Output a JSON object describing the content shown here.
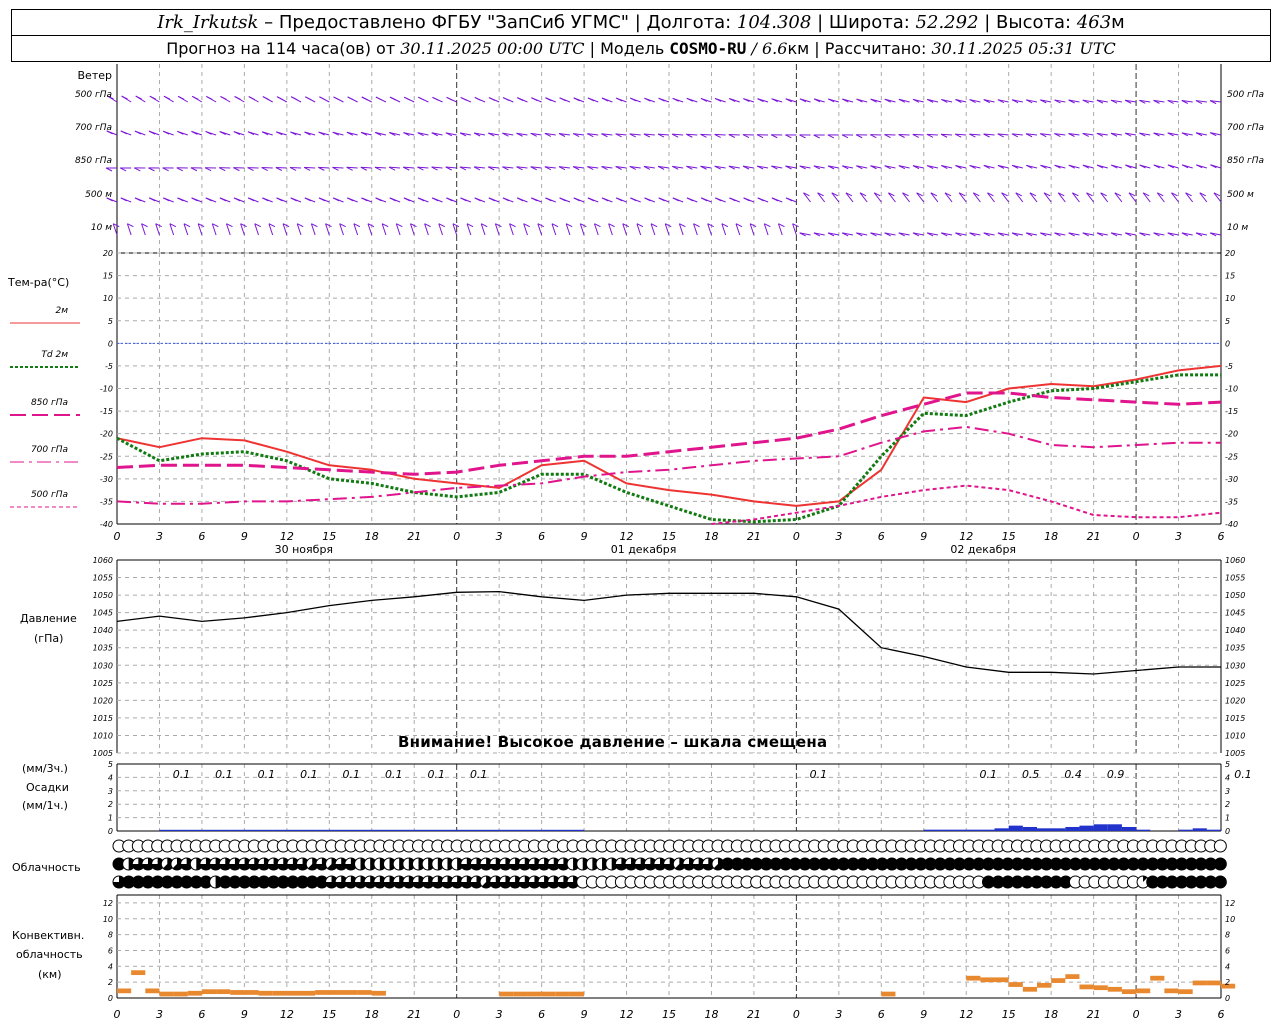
{
  "header": {
    "line1": {
      "station": "Irk_Irkutsk",
      "provider": " – Предоставлено ФГБУ \"ЗапСиб УГМС\" | Долгота: ",
      "lon": "104.308",
      "lat_label": " | Широта: ",
      "lat": "52.292",
      "alt_label": " | Высота: ",
      "alt": "463",
      "alt_unit": "м"
    },
    "line2": {
      "prefix": "Прогноз на 114 часа(ов) от ",
      "run_time": "30.11.2025 00:00 UTC",
      "model_label": "  | Модель ",
      "model": "COSMO-RU",
      "sep": " / ",
      "res": "6.6",
      "res_unit": "км",
      "calc_label": " | Рассчитано: ",
      "calc_time": "30.11.2025 05:31 UTC"
    }
  },
  "wind_panel": {
    "title": "Ветер",
    "levels": [
      "500 гПа",
      "700 гПа",
      "850 гПа",
      "500 м",
      "10 м"
    ],
    "barb_color": "#7a16d6"
  },
  "temp_panel": {
    "title": "Тем-ра(°C)",
    "legend": [
      {
        "label": "2м",
        "color": "#ee3333"
      },
      {
        "label": "Td  2м",
        "color": "#117a11"
      },
      {
        "label": "850 гПа",
        "color": "#e0148c"
      },
      {
        "label": "700 гПа",
        "color": "#e0148c"
      },
      {
        "label": "500 гПа",
        "color": "#e0148c"
      }
    ]
  },
  "time_axis": {
    "hours": [
      "0",
      "3",
      "6",
      "9",
      "12",
      "15",
      "18",
      "21",
      "0",
      "3",
      "6",
      "9",
      "12",
      "15",
      "18",
      "21",
      "0",
      "3",
      "6",
      "9",
      "12",
      "15",
      "18",
      "21",
      "0",
      "3",
      "6"
    ],
    "dates": [
      "30 ноября",
      "01 декабря",
      "02 декабря"
    ]
  },
  "pressure_panel": {
    "title_line1": "Давление",
    "title_line2": "(гПа)",
    "warning": "Внимание! Высокое давление – шкала смещена"
  },
  "precip_panel": {
    "label_line1": "(мм/3ч.)",
    "label_line2": "Осадки",
    "label_line3": "(мм/1ч.)",
    "totals_3h": [
      {
        "hour": 3,
        "value": "0.1"
      },
      {
        "hour": 6,
        "value": "0.1"
      },
      {
        "hour": 9,
        "value": "0.1"
      },
      {
        "hour": 12,
        "value": "0.1"
      },
      {
        "hour": 15,
        "value": "0.1"
      },
      {
        "hour": 18,
        "value": "0.1"
      },
      {
        "hour": 21,
        "value": "0.1"
      },
      {
        "hour": 24,
        "value": "0.1"
      },
      {
        "hour": 48,
        "value": "0.1"
      },
      {
        "hour": 60,
        "value": "0.1"
      },
      {
        "hour": 63,
        "value": "0.5"
      },
      {
        "hour": 66,
        "value": "0.4"
      },
      {
        "hour": 69,
        "value": "0.9"
      },
      {
        "hour": 78,
        "value": "0.1"
      }
    ],
    "bar_color": "#2233cc"
  },
  "cloud_panel": {
    "title": "Облачность"
  },
  "conv_panel": {
    "title_line1": "Конвективн.",
    "title_line2": "облачность",
    "title_line3": "(км)",
    "bar_color": "#e8882f"
  },
  "chart_data": [
    {
      "type": "line",
      "title": "Тем-ра(°C)",
      "x_unit": "hours from 30.11.2025 00:00 UTC",
      "ylim": [
        -40,
        20
      ],
      "yticks": [
        -40,
        -35,
        -30,
        -25,
        -20,
        -15,
        -10,
        -5,
        0,
        5,
        10,
        15,
        20
      ],
      "x": [
        0,
        3,
        6,
        9,
        12,
        15,
        18,
        21,
        24,
        27,
        30,
        33,
        36,
        39,
        42,
        45,
        48,
        51,
        54,
        57,
        60,
        63,
        66,
        69,
        72,
        75,
        78
      ],
      "series": [
        {
          "name": "2м",
          "values": [
            -21,
            -23,
            -21,
            -21.5,
            -24,
            -27,
            -28,
            -30,
            -31,
            -32,
            -27,
            -26,
            -31,
            -32.5,
            -33.5,
            -35,
            -36,
            -35,
            -28,
            -12,
            -13,
            -10,
            -9,
            -9.5,
            -8,
            -6,
            -5
          ]
        },
        {
          "name": "Td  2м",
          "values": [
            -21,
            -26,
            -24.5,
            -24,
            -26,
            -30,
            -31,
            -33,
            -34,
            -33,
            -29,
            -29,
            -33,
            -36,
            -39,
            -39.5,
            -39,
            -36,
            -25,
            -15.5,
            -16,
            -13,
            -10.5,
            -10,
            -8.5,
            -7,
            -7
          ]
        },
        {
          "name": "850 гПа",
          "values": [
            -27.5,
            -27,
            -27,
            -27,
            -27.5,
            -28,
            -28.5,
            -29,
            -28.5,
            -27,
            -26,
            -25,
            -25,
            -24,
            -23,
            -22,
            -21,
            -19,
            -16,
            -13.5,
            -11,
            -11,
            -12,
            -12.5,
            -13,
            -13.5,
            -13
          ]
        },
        {
          "name": "700 гПа",
          "values": [
            -35,
            -35.5,
            -35.5,
            -35,
            -35,
            -34.5,
            -34,
            -33,
            -32,
            -31.5,
            -31,
            -29.5,
            -28.5,
            -28,
            -27,
            -26,
            -25.5,
            -25,
            -22,
            -19.5,
            -18.5,
            -20,
            -22.5,
            -23,
            -22.5,
            -22,
            -22
          ]
        },
        {
          "name": "500 гПа",
          "values": [
            null,
            null,
            null,
            null,
            null,
            null,
            null,
            null,
            null,
            null,
            null,
            null,
            null,
            null,
            -40,
            -39,
            -37.5,
            -36,
            -34,
            -32.5,
            -31.5,
            -32.5,
            -35,
            -38,
            -38.5,
            -38.5,
            -37.5
          ]
        }
      ]
    },
    {
      "type": "line",
      "title": "Давление",
      "ylim": [
        1005,
        1060
      ],
      "yticks": [
        1005,
        1010,
        1015,
        1020,
        1025,
        1030,
        1035,
        1040,
        1045,
        1050,
        1055,
        1060
      ],
      "x": [
        0,
        3,
        6,
        9,
        12,
        15,
        18,
        21,
        24,
        27,
        30,
        33,
        36,
        39,
        42,
        45,
        48,
        51,
        54,
        57,
        60,
        63,
        66,
        69,
        72,
        75,
        78
      ],
      "series": [
        {
          "name": "",
          "values": [
            1042.5,
            1044,
            1042.5,
            1043.5,
            1045,
            1047,
            1048.5,
            1049.5,
            1050.8,
            1051,
            1049.5,
            1048.5,
            1050,
            1050.5,
            1050.5,
            1050.5,
            1049.5,
            1046,
            1035,
            1032.5,
            1029.5,
            1028,
            1028,
            1027.5,
            1028.5,
            1029.5,
            1029.5
          ]
        }
      ]
    },
    {
      "type": "bar",
      "title": "Осадки",
      "ylim": [
        0,
        5
      ],
      "yticks": [
        0,
        1,
        2,
        3,
        4,
        5
      ],
      "x": [
        57,
        58,
        59,
        60,
        61,
        62,
        63,
        64,
        65,
        66,
        67,
        68,
        69,
        70,
        71,
        72,
        75,
        76,
        77
      ],
      "series": [
        {
          "name": "",
          "values": [
            0.1,
            0.1,
            0.1,
            0.1,
            0.1,
            0.2,
            0.4,
            0.3,
            0.2,
            0.2,
            0.3,
            0.4,
            0.5,
            0.5,
            0.3,
            0.1,
            0.1,
            0.2,
            0.1
          ]
        }
      ]
    },
    {
      "type": "bar",
      "title": "Конвективн. облачность",
      "ylim": [
        0,
        13
      ],
      "yticks": [
        0,
        2,
        4,
        6,
        8,
        10,
        12
      ],
      "x": [
        0,
        1,
        2,
        3,
        4,
        5,
        6,
        7,
        8,
        9,
        10,
        11,
        12,
        13,
        14,
        15,
        16,
        17,
        18,
        27,
        28,
        29,
        30,
        31,
        32,
        54,
        60,
        61,
        62,
        63,
        64,
        65,
        66,
        67,
        68,
        69,
        70,
        71,
        72,
        73,
        74,
        75,
        76,
        77,
        78
      ],
      "series": [
        {
          "name": "",
          "values": [
            1.2,
            3.5,
            1.2,
            0.8,
            0.8,
            0.9,
            1.1,
            1.1,
            1.0,
            1.0,
            0.9,
            0.9,
            0.9,
            0.9,
            1.0,
            1.0,
            1.0,
            1.0,
            0.9,
            0.8,
            0.8,
            0.8,
            0.8,
            0.8,
            0.8,
            0.8,
            2.8,
            2.6,
            2.6,
            2.0,
            1.4,
            1.9,
            2.5,
            3.0,
            1.7,
            1.6,
            1.4,
            1.1,
            1.2,
            2.8,
            1.2,
            1.1,
            2.2,
            2.2,
            1.8
          ]
        }
      ]
    },
    {
      "type": "table",
      "title": "Облачность",
      "note": "cloud cover in eighths per hour, rows: top/middle/bottom",
      "rows": [
        [
          0,
          0,
          0,
          0,
          0,
          0,
          0,
          0,
          0,
          0,
          0,
          0,
          0,
          0,
          0,
          0,
          0,
          0,
          0,
          0,
          0,
          0,
          0,
          0,
          0,
          0,
          0,
          0,
          0,
          0,
          0,
          0,
          0,
          0,
          0,
          0,
          0,
          0,
          0,
          0,
          0,
          0,
          0,
          0,
          0,
          0,
          0,
          0,
          0,
          0,
          0,
          0,
          0,
          0,
          0,
          0,
          0,
          0,
          0,
          0,
          0,
          0,
          0,
          0,
          0,
          0,
          0,
          0,
          0,
          0,
          0,
          0,
          0,
          0,
          0,
          0,
          0,
          0,
          0,
          0,
          0,
          0,
          0,
          0,
          0,
          0,
          0,
          0,
          0,
          0,
          0,
          0,
          0,
          0,
          0,
          0,
          0,
          0,
          0,
          0,
          0,
          0,
          0,
          0,
          0,
          0,
          0,
          0,
          0,
          0,
          0,
          0,
          0,
          0,
          0,
          0,
          0,
          0,
          0,
          0,
          0
        ],
        [
          8,
          4,
          6,
          6,
          6,
          5,
          5,
          6,
          4,
          6,
          6,
          6,
          6,
          6,
          6,
          6,
          6,
          6,
          6,
          6,
          5,
          6,
          5,
          6,
          6,
          4,
          4,
          4,
          4,
          4,
          4,
          4,
          4,
          4,
          4,
          4,
          6,
          6,
          6,
          6,
          6,
          6,
          6,
          6,
          6,
          6,
          6,
          4,
          4,
          4,
          4,
          4,
          6,
          6,
          6,
          6,
          6,
          6,
          5,
          6,
          6,
          6,
          5,
          8,
          8,
          8,
          8,
          8,
          8,
          8,
          8,
          8,
          8,
          8,
          8,
          8,
          8,
          8,
          8,
          8,
          8,
          8,
          8,
          8,
          8,
          8,
          8,
          8,
          8,
          8,
          8,
          8,
          8,
          8,
          8,
          8,
          8,
          8,
          8,
          8,
          8,
          8,
          8,
          8,
          8,
          8,
          8,
          8,
          8,
          8,
          8,
          8,
          8,
          8,
          8
        ],
        [
          6,
          8,
          8,
          8,
          8,
          8,
          8,
          8,
          8,
          8,
          4,
          8,
          8,
          8,
          8,
          8,
          8,
          8,
          8,
          8,
          8,
          8,
          6,
          6,
          6,
          6,
          6,
          6,
          6,
          6,
          6,
          6,
          6,
          6,
          6,
          6,
          6,
          6,
          5,
          6,
          6,
          6,
          6,
          6,
          6,
          6,
          6,
          6,
          0,
          0,
          0,
          0,
          0,
          0,
          0,
          0,
          0,
          0,
          0,
          0,
          0,
          0,
          0,
          0,
          0,
          0,
          0,
          0,
          0,
          0,
          0,
          0,
          0,
          0,
          0,
          0,
          0,
          0,
          0,
          0,
          0,
          0,
          0,
          0,
          0,
          0,
          0,
          0,
          0,
          0,
          8,
          8,
          8,
          8,
          8,
          8,
          8,
          8,
          8,
          0,
          0,
          0,
          0,
          0,
          0,
          0,
          1,
          8,
          8,
          8,
          8,
          8,
          8,
          8,
          8,
          8,
          8,
          8,
          8,
          8,
          8
        ]
      ]
    }
  ]
}
